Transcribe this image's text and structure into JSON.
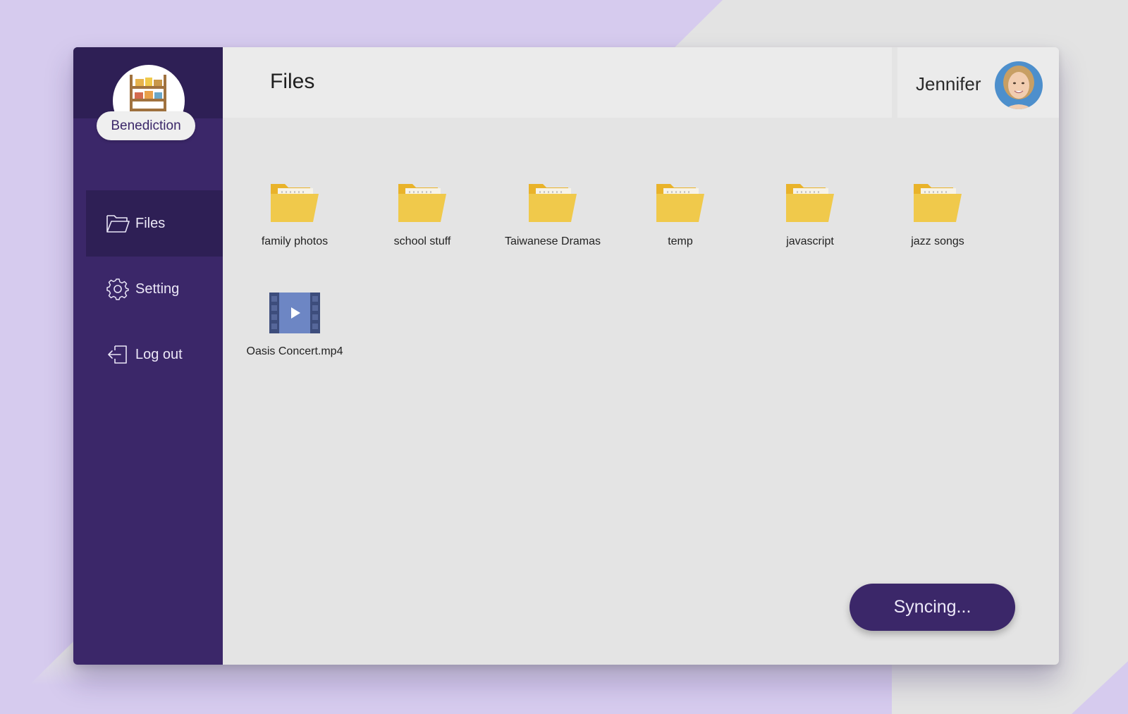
{
  "app": {
    "brand_name": "Benediction"
  },
  "sidebar": {
    "items": [
      {
        "label": "Files",
        "icon": "folder-outline-icon",
        "active": true
      },
      {
        "label": "Setting",
        "icon": "gear-icon",
        "active": false
      },
      {
        "label": "Log out",
        "icon": "logout-icon",
        "active": false
      }
    ]
  },
  "header": {
    "title": "Files"
  },
  "user": {
    "name": "Jennifer"
  },
  "files": [
    {
      "name": "family photos",
      "type": "folder"
    },
    {
      "name": "school stuff",
      "type": "folder"
    },
    {
      "name": "Taiwanese Dramas",
      "type": "folder"
    },
    {
      "name": "temp",
      "type": "folder"
    },
    {
      "name": "javascript",
      "type": "folder"
    },
    {
      "name": "jazz songs",
      "type": "folder"
    },
    {
      "name": "Oasis Concert.mp4",
      "type": "video"
    }
  ],
  "sync": {
    "label": "Syncing..."
  },
  "colors": {
    "sidebar": "#3b2769",
    "sidebar_dark": "#2e1f55",
    "folder": "#f0c94b",
    "accent_bg": "#d6cbee"
  }
}
